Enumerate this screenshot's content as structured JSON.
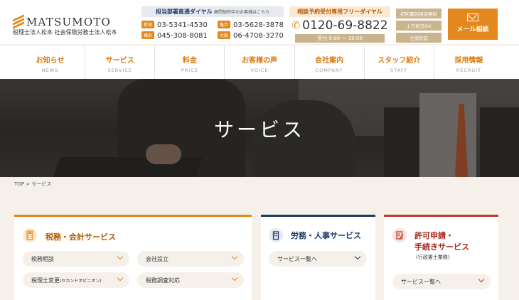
{
  "header": {
    "logo_text": "MATSUMOTO",
    "logo_sub": "税理士法人松本 社会保険労務士法人松本",
    "dial": {
      "title": "担当部署直通ダイヤル",
      "note": "顧問契約中のお客様はこちら",
      "rows": [
        {
          "label": "新宿",
          "number": "03-5341-4530"
        },
        {
          "label": "亀戸",
          "number": "03-5628-3878"
        },
        {
          "label": "横浜",
          "number": "045-308-8081"
        },
        {
          "label": "大阪",
          "number": "06-4708-3270"
        }
      ]
    },
    "free_dial": {
      "title": "相談予約受付専用フリーダイヤル",
      "number": "0120-69-8822",
      "hours": "受付 9:00 〜 19:00"
    },
    "tags": [
      "初回電話相談無料",
      "土日祝日OK",
      "全国対応"
    ],
    "mail_button": "メール相談"
  },
  "nav": [
    {
      "jp": "お知らせ",
      "en": "NEWS"
    },
    {
      "jp": "サービス",
      "en": "SERVICE"
    },
    {
      "jp": "料金",
      "en": "PRICE"
    },
    {
      "jp": "お客様の声",
      "en": "VOICE"
    },
    {
      "jp": "会社案内",
      "en": "COMPANY"
    },
    {
      "jp": "スタッフ紹介",
      "en": "STAFF"
    },
    {
      "jp": "採用情報",
      "en": "RECRUIT"
    }
  ],
  "hero": {
    "title": "サービス"
  },
  "breadcrumb": {
    "home": "TOP",
    "separator": ">",
    "current": "サービス"
  },
  "cards": [
    {
      "title": "税務・会計サービス",
      "accent": "#e3881d",
      "buttons": [
        {
          "label": "税務相談"
        },
        {
          "label": "会社設立"
        },
        {
          "label": "税理士変更",
          "note": "(セカンドオピニオン)"
        },
        {
          "label": "税務調査対応"
        }
      ]
    },
    {
      "title": "労務・人事サービス",
      "accent": "#1f3a68",
      "buttons": [
        {
          "label": "サービス一覧へ"
        }
      ]
    },
    {
      "title_line1": "許可申請・",
      "title_line2": "手続きサービス",
      "note": "(行政書士業務)",
      "accent": "#c0392b",
      "buttons": [
        {
          "label": "サービス一覧へ"
        }
      ]
    }
  ]
}
